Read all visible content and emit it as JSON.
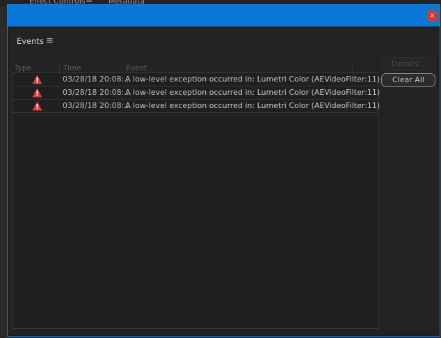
{
  "background_tabs": [
    {
      "label": "Effect Controls",
      "menu": "≡"
    },
    {
      "label": "Metadata"
    }
  ],
  "window": {
    "close_label": "x"
  },
  "panel": {
    "title": "Events",
    "menu_icon": "≡"
  },
  "columns": [
    "Type",
    "Time",
    "Event"
  ],
  "rows": [
    {
      "type_icon": "warning-icon",
      "time": "03/28/18 20:08:...",
      "event": "A low-level exception occurred in: Lumetri Color (AEVideoFilter:11)"
    },
    {
      "type_icon": "warning-icon",
      "time": "03/28/18 20:08:...",
      "event": "A low-level exception occurred in: Lumetri Color (AEVideoFilter:11)"
    },
    {
      "type_icon": "warning-icon",
      "time": "03/28/18 20:08:...",
      "event": "A low-level exception occurred in: Lumetri Color (AEVideoFilter:11)"
    }
  ],
  "buttons": {
    "details": "Details...",
    "clear_all": "Clear All"
  },
  "colors": {
    "titlebar": "#0a78d8",
    "close": "#c0403b",
    "warning": "#e03b3b"
  }
}
